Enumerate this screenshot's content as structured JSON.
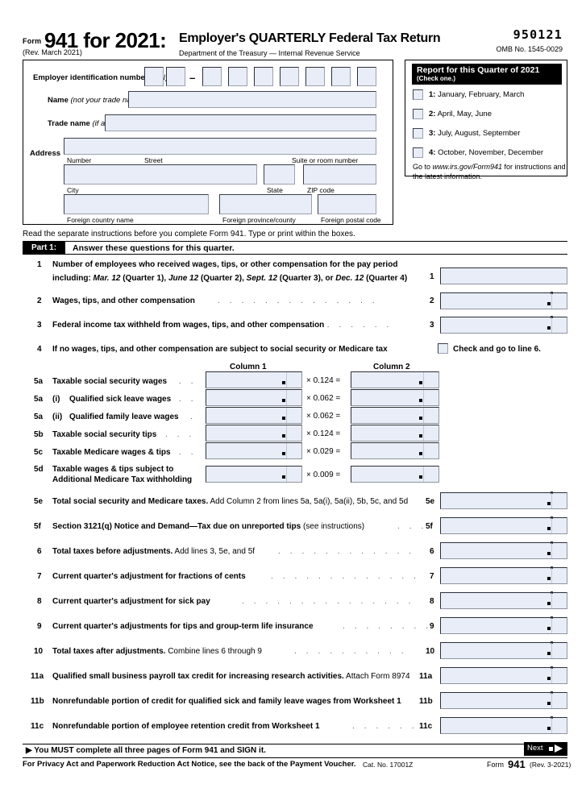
{
  "header": {
    "form_word": "Form",
    "form_number_title": "941 for 2021:",
    "title": "Employer's QUARTERLY Federal Tax Return",
    "revision": "(Rev. March 2021)",
    "department": "Department of the Treasury  —  Internal Revenue Service",
    "ocr_code": "950121",
    "omb": "OMB No. 1545-0029"
  },
  "entity": {
    "ein_label": "Employer identification number",
    "ein_label_paren": "(EIN)",
    "name_label": "Name",
    "name_label_paren": "(not your trade name)",
    "trade_label": "Trade name",
    "trade_label_paren": "(if any)",
    "address_label": "Address",
    "sub_number": "Number",
    "sub_street": "Street",
    "sub_suite": "Suite or room number",
    "sub_city": "City",
    "sub_state": "State",
    "sub_zip": "ZIP code",
    "sub_country": "Foreign country name",
    "sub_province": "Foreign province/county",
    "sub_postal": "Foreign postal code",
    "ein_boxes": 9
  },
  "quarter": {
    "banner_title": "Report for this Quarter of 2021",
    "banner_sub": "(Check one.)",
    "options": [
      {
        "num": "1:",
        "label": "January, February, March"
      },
      {
        "num": "2:",
        "label": "April, May, June"
      },
      {
        "num": "3:",
        "label": "July, August, September"
      },
      {
        "num": "4:",
        "label": "October, November, December"
      }
    ],
    "goto_pre": "Go to ",
    "goto_url": "www.irs.gov/Form941",
    "goto_post": " for instructions and the latest information."
  },
  "part1": {
    "read_instruction": "Read the separate instructions before you complete Form 941. Type or print within the boxes.",
    "tag": "Part 1:",
    "heading": "Answer these questions for this quarter.",
    "column1_header": "Column 1",
    "column2_header": "Column 2",
    "line4_checkbox_label": "Check and go to line 6."
  },
  "lines": {
    "l1_no": "1",
    "l1_text_a": "Number of employees who received wages, tips, or other compensation for the pay period",
    "l1_text_b1": "including: ",
    "l1_text_b2": "Mar. 12",
    "l1_text_b3": " (Quarter 1), ",
    "l1_text_b4": "June 12",
    "l1_text_b5": " (Quarter 2), ",
    "l1_text_b6": "Sept. 12",
    "l1_text_b7": " (Quarter 3), or ",
    "l1_text_b8": "Dec. 12",
    "l1_text_b9": " (Quarter 4)",
    "l1_rno": "1",
    "l2_no": "2",
    "l2_text": "Wages, tips, and other compensation",
    "l2_rno": "2",
    "l3_no": "3",
    "l3_text": "Federal income tax withheld from wages, tips, and other compensation",
    "l3_rno": "3",
    "l4_no": "4",
    "l4_text": "If no wages, tips, and other compensation are subject to social security or Medicare tax",
    "l5a_no": "5a",
    "l5a_text": "Taxable social security wages",
    "l5a_rate": "× 0.124 =",
    "l5ai_no": "5a",
    "l5ai_roman": "(i)",
    "l5ai_text": "Qualified sick leave wages",
    "l5ai_rate": "× 0.062 =",
    "l5aii_no": "5a",
    "l5aii_roman": "(ii)",
    "l5aii_text": "Qualified family leave wages",
    "l5aii_rate": "× 0.062 =",
    "l5b_no": "5b",
    "l5b_text": "Taxable social security tips",
    "l5b_rate": "× 0.124 =",
    "l5c_no": "5c",
    "l5c_text": "Taxable Medicare wages & tips",
    "l5c_rate": "× 0.029 =",
    "l5d_no": "5d",
    "l5d_text_a": "Taxable wages & tips subject to",
    "l5d_text_b": "Additional Medicare Tax withholding",
    "l5d_rate": "× 0.009 =",
    "l5e_no": "5e",
    "l5e_bold": "Total social security and Medicare taxes.",
    "l5e_reg": " Add Column 2 from lines 5a, 5a(i), 5a(ii), 5b, 5c, and 5d",
    "l5e_rno": "5e",
    "l5f_no": "5f",
    "l5f_bold": "Section 3121(q) Notice and Demand—Tax due on unreported tips",
    "l5f_reg": " (see instructions)",
    "l5f_rno": "5f",
    "l6_no": "6",
    "l6_bold": "Total taxes before adjustments.",
    "l6_reg": " Add lines 3, 5e, and 5f",
    "l6_rno": "6",
    "l7_no": "7",
    "l7_text": "Current quarter's adjustment for fractions of cents",
    "l7_rno": "7",
    "l8_no": "8",
    "l8_text": "Current quarter's adjustment for sick pay",
    "l8_rno": "8",
    "l9_no": "9",
    "l9_text": "Current quarter's adjustments for tips and group-term life insurance",
    "l9_rno": "9",
    "l10_no": "10",
    "l10_bold": "Total taxes after adjustments.",
    "l10_reg": " Combine lines 6 through 9",
    "l10_rno": "10",
    "l11a_no": "11a",
    "l11a_bold": "Qualified small business payroll tax credit for increasing research activities.",
    "l11a_reg": " Attach Form 8974",
    "l11a_rno": "11a",
    "l11b_no": "11b",
    "l11b_text": "Nonrefundable portion of credit for qualified sick and family leave wages from Worksheet 1",
    "l11b_rno": "11b",
    "l11c_no": "11c",
    "l11c_text": "Nonrefundable portion of employee retention credit from Worksheet 1",
    "l11c_rno": "11c"
  },
  "dots": {
    "d2": ". . . . . . . . . . . . . .",
    "d3": ". . . . . . .",
    "d5f": ". . .",
    "d6": ". . . . . . . . . . . .",
    "d7": ". . . . . . . . . . . . .",
    "d8": ". . . . . . . . . . . . . . .",
    "d9": ". . . . . . . .",
    "d10": ". . . . . . . . . .",
    "d11c": ". . . . . . ."
  },
  "footer": {
    "must_text": "You MUST complete all three pages of Form 941 and SIGN it.",
    "privacy": "For Privacy Act and Paperwork Reduction Act Notice, see the back of the Payment Voucher.",
    "cat_no": "Cat. No. 17001Z",
    "form_word": "Form",
    "form_num": "941",
    "form_rev": "(Rev. 3-2021)",
    "next_label": "Next"
  },
  "colors": {
    "field_fill": "#e9edf7",
    "field_border": "#8e939f",
    "ink": "#000000"
  }
}
